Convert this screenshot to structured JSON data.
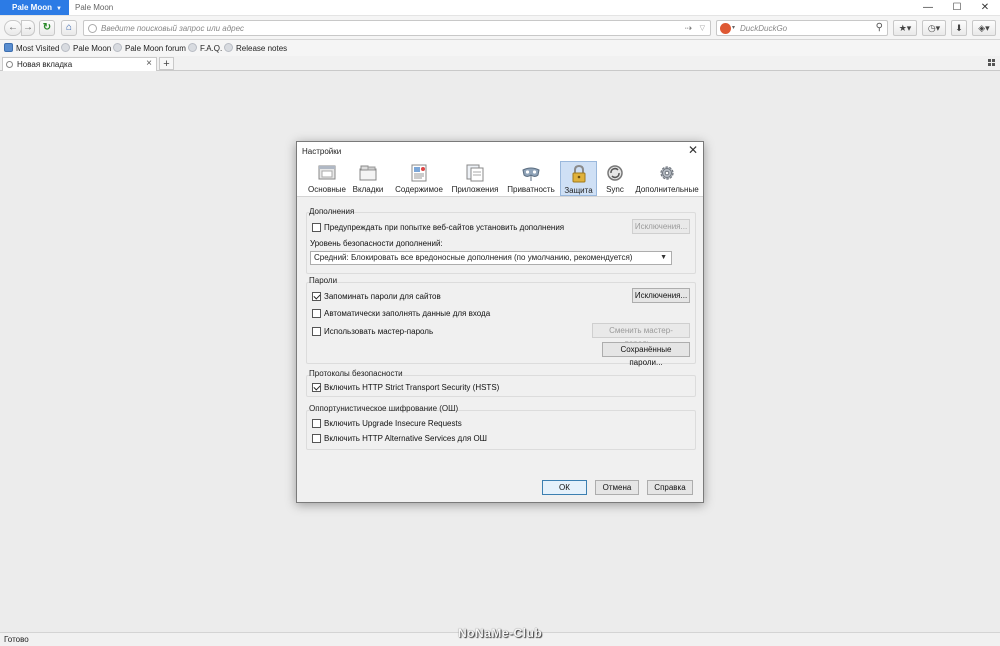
{
  "window": {
    "app_button": "Pale Moon",
    "title": "Pale Moon",
    "minimize": "—",
    "maximize": "☐",
    "close": "✕"
  },
  "nav": {
    "url_placeholder": "Введите поисковый запрос или адрес",
    "search_placeholder": "DuckDuckGo"
  },
  "bookmarks": [
    "Most Visited",
    "Pale Moon",
    "Pale Moon forum",
    "F.A.Q.",
    "Release notes"
  ],
  "tabs": [
    {
      "label": "Новая вкладка"
    }
  ],
  "status": {
    "text": "Готово",
    "watermark": "NoNaMe-Club"
  },
  "dialog": {
    "title": "Настройки",
    "panes": [
      {
        "label": "Основные",
        "icon": "general-icon"
      },
      {
        "label": "Вкладки",
        "icon": "tabs-icon"
      },
      {
        "label": "Содержимое",
        "icon": "content-icon"
      },
      {
        "label": "Приложения",
        "icon": "applications-icon"
      },
      {
        "label": "Приватность",
        "icon": "privacy-mask-icon"
      },
      {
        "label": "Защита",
        "icon": "lock-icon",
        "selected": true
      },
      {
        "label": "Sync",
        "icon": "sync-icon"
      },
      {
        "label": "Дополнительные",
        "icon": "gear-icon"
      }
    ],
    "addons": {
      "heading": "Дополнения",
      "warn_label": "Предупреждать при попытке веб-сайтов установить дополнения",
      "warn_checked": false,
      "exceptions_button": "Исключения...",
      "security_level_label": "Уровень безопасности дополнений:",
      "security_level_value": "Средний: Блокировать все вредоносные дополнения (по умолчанию, рекомендуется)"
    },
    "passwords": {
      "heading": "Пароли",
      "remember_label": "Запоминать пароли для сайтов",
      "remember_checked": true,
      "autofill_label": "Автоматически заполнять данные для входа",
      "autofill_checked": false,
      "master_label": "Использовать мастер-пароль",
      "master_checked": false,
      "exceptions_button": "Исключения...",
      "change_master_button": "Сменить мастер-пароль...",
      "saved_button": "Сохранённые пароли..."
    },
    "protocols": {
      "heading": "Протоколы безопасности",
      "hsts_label": "Включить HTTP Strict Transport Security (HSTS)",
      "hsts_checked": true
    },
    "oe": {
      "heading": "Оппортунистическое шифрование (ОШ)",
      "upgrade_label": "Включить Upgrade Insecure Requests",
      "upgrade_checked": false,
      "altsvc_label": "Включить HTTP Alternative Services для ОШ",
      "altsvc_checked": false
    },
    "buttons": {
      "ok": "ОК",
      "cancel": "Отмена",
      "help": "Справка"
    }
  }
}
